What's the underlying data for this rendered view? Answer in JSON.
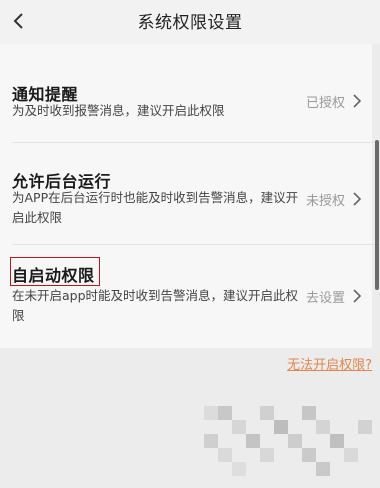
{
  "header": {
    "title": "系统权限设置"
  },
  "rows": [
    {
      "title": "通知提醒",
      "desc": "为及时收到报警消息，建议开启此权限",
      "status": "已授权"
    },
    {
      "title": "允许后台运行",
      "desc": "为APP在后台运行时也能及时收到告警消息，建议开启此权限",
      "status": "未授权"
    },
    {
      "title": "自启动权限",
      "desc": "在未开启app时能及时收到告警消息，建议开启此权限",
      "status": "去设置"
    }
  ],
  "help_link": "无法开启权限?"
}
